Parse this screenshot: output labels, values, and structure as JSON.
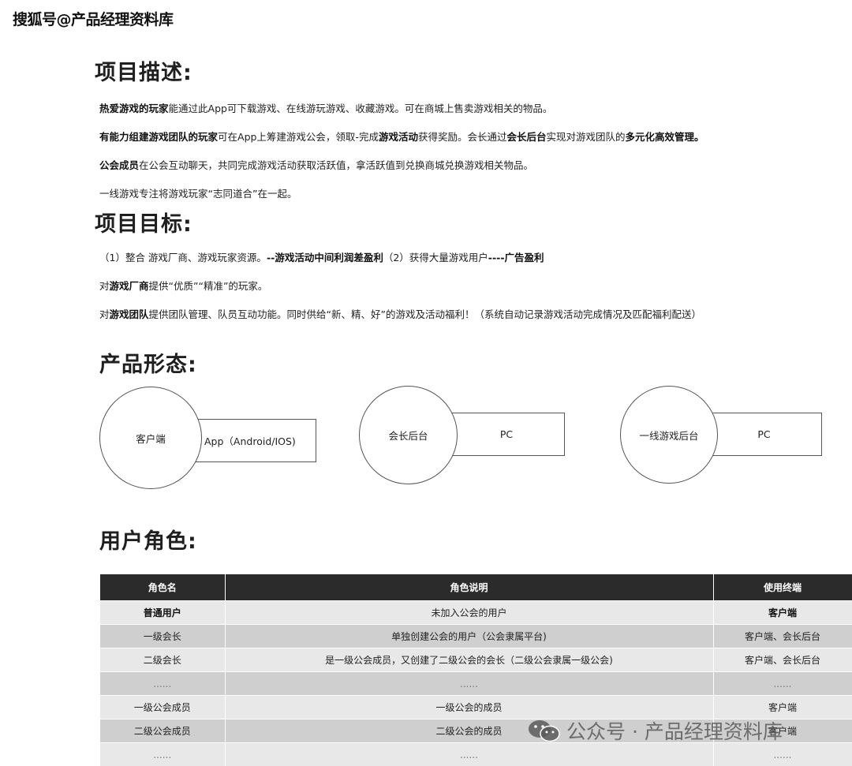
{
  "watermark_top": "搜狐号@产品经理资料库",
  "sections": {
    "desc_title": "项目描述:",
    "goal_title": "项目目标:",
    "form_title": "产品形态:",
    "roles_title": "用户角色:"
  },
  "desc": {
    "p1_b": "热爱游戏的玩家",
    "p1_t": "能通过此App可下载游戏、在线游玩游戏、收藏游戏。可在商城上售卖游戏相关的物品。",
    "p2_b1": "有能力组建游戏团队的玩家",
    "p2_t1": "可在App上筹建游戏公会，领取-完成",
    "p2_b2": "游戏活动",
    "p2_t2": "获得奖励。会长通过",
    "p2_b3": "会长后台",
    "p2_t3": "实现对游戏团队的",
    "p2_b4": "多元化高效管理。",
    "p3_b": "公会成员",
    "p3_t": "在公会互动聊天，共同完成游戏活动获取活跃值，拿活跃值到兑换商城兑换游戏相关物品。",
    "p4_t": "一线游戏专注将游戏玩家“志同道合”在一起。"
  },
  "goal": {
    "g1_t1": "（1）整合 游戏厂商、游戏玩家资源。",
    "g1_b1": "--游戏活动中间利润差盈利",
    "g1_t2": "（2）获得大量游戏用户",
    "g1_b2": "----广告盈利",
    "g2_t1": "对",
    "g2_b": "游戏厂商",
    "g2_t2": "提供“优质”“精准”的玩家。",
    "g3_t1": "对",
    "g3_b": "游戏团队",
    "g3_t2": "提供团队管理、队员互动功能。同时供给“新、精、好”的游戏及活动福利！（系统自动记录游戏活动完成情况及匹配福利配送）"
  },
  "forms": [
    {
      "circle": "客户端",
      "box": "App（Android/IOS)"
    },
    {
      "circle": "会长后台",
      "box": "PC"
    },
    {
      "circle": "一线游戏后台",
      "box": "PC"
    }
  ],
  "table": {
    "headers": [
      "角色名",
      "角色说明",
      "使用终端"
    ],
    "rows": [
      [
        "普通用户",
        "未加入公会的用户",
        "客户端"
      ],
      [
        "一级会长",
        "单独创建公会的用户（公会隶属平台)",
        "客户端、会长后台"
      ],
      [
        "二级会长",
        "是一级公会成员，又创建了二级公会的会长（二级公会隶属一级公会)",
        "客户端、会长后台"
      ],
      [
        "......",
        "......",
        "......"
      ],
      [
        "一级公会成员",
        "一级公会的成员",
        "客户端"
      ],
      [
        "二级公会成员",
        "二级公会的成员",
        "客户端"
      ],
      [
        "......",
        "......",
        "......"
      ]
    ]
  },
  "watermark_bottom": "公众号 · 产品经理资料库",
  "colors": {
    "header_bg": "#2b2b2b",
    "row_light": "#e8e8e8",
    "row_dark": "#cfcfcf"
  }
}
